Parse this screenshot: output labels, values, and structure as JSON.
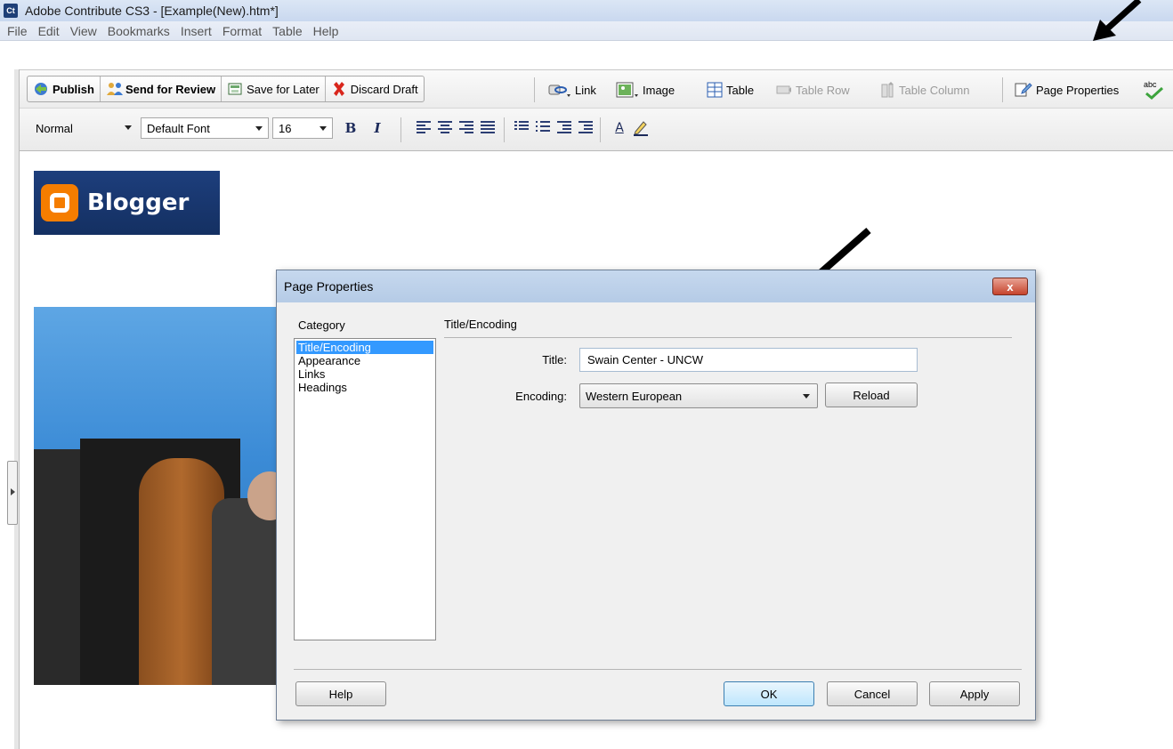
{
  "window": {
    "app_icon_text": "Ct",
    "title": "Adobe Contribute CS3 - [Example(New).htm*]"
  },
  "menu": [
    "File",
    "Edit",
    "View",
    "Bookmarks",
    "Insert",
    "Format",
    "Table",
    "Help"
  ],
  "toolbar": {
    "publish": "Publish",
    "send_for_review": "Send for Review",
    "save_for_later": "Save for Later",
    "discard_draft": "Discard Draft",
    "link": "Link",
    "image": "Image",
    "table": "Table",
    "table_row": "Table Row",
    "table_column": "Table Column",
    "page_properties": "Page Properties",
    "spell_icon_text": "abc"
  },
  "format_bar": {
    "style": "Normal",
    "font": "Default Font",
    "size": "16",
    "bold": "B",
    "italic": "I",
    "text_color": "A"
  },
  "content": {
    "blogger_text": "Blogger"
  },
  "dialog": {
    "title": "Page Properties",
    "close": "x",
    "category_label": "Category",
    "categories": [
      "Title/Encoding",
      "Appearance",
      "Links",
      "Headings"
    ],
    "section_label": "Title/Encoding",
    "title_label": "Title:",
    "title_value": "Swain Center - UNCW",
    "encoding_label": "Encoding:",
    "encoding_value": "Western European",
    "reload": "Reload",
    "help": "Help",
    "ok": "OK",
    "cancel": "Cancel",
    "apply": "Apply"
  },
  "colors": {
    "selection": "#3399ff",
    "blogger_orange": "#f57d00",
    "blogger_navy": "#1d3e7c"
  }
}
